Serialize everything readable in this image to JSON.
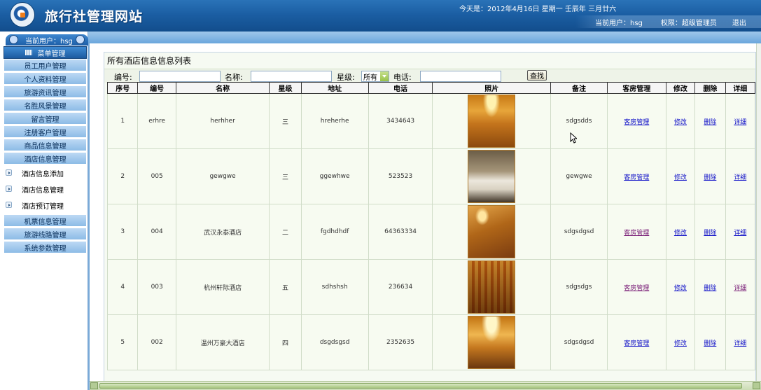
{
  "header": {
    "site_title": "旅行社管理网站",
    "date_text": "今天是：2012年4月16日 星期一 壬辰年 三月廿六",
    "current_user": "当前用户：hsg",
    "role": "权限：超级管理员",
    "logout": "退出"
  },
  "sidebar": {
    "user_label": "当前用户：hsg",
    "menu_head": "菜单管理",
    "items": [
      "员工用户管理",
      "个人资料管理",
      "旅游资讯管理",
      "名胜风景管理",
      "留言管理",
      "注册客户管理",
      "商品信息管理",
      "酒店信息管理"
    ],
    "sub_items": [
      "酒店信息添加",
      "酒店信息管理",
      "酒店预订管理"
    ],
    "items_after": [
      "机票信息管理",
      "旅游线路管理",
      "系统参数管理"
    ]
  },
  "panel": {
    "title": "所有酒店信息信息列表",
    "search": {
      "code_label": "编号:",
      "name_label": "名称:",
      "star_label": "星级:",
      "star_selected": "所有",
      "phone_label": "电话:",
      "button": "查找"
    }
  },
  "table": {
    "headers": [
      "序号",
      "编号",
      "名称",
      "星级",
      "地址",
      "电话",
      "照片",
      "备注",
      "客房管理",
      "修改",
      "删除",
      "详细"
    ],
    "rows": [
      {
        "no": "1",
        "code": "erhre",
        "name": "herhher",
        "star": "三",
        "addr": "hreherhe",
        "phone": "3434643",
        "photo": "ph-gold",
        "note": "sdgsdds",
        "room": "客房管理",
        "edit": "修改",
        "del": "删除",
        "detail": "详细"
      },
      {
        "no": "2",
        "code": "005",
        "name": "gewgwe",
        "star": "三",
        "addr": "ggewhwe",
        "phone": "523523",
        "photo": "ph-room",
        "note": "gewgwe",
        "room": "客房管理",
        "edit": "修改",
        "del": "删除",
        "detail": "详细"
      },
      {
        "no": "3",
        "code": "004",
        "name": "武汉永泰酒店",
        "star": "二",
        "addr": "fgdhdhdf",
        "phone": "64363334",
        "photo": "ph-warm",
        "note": "sdgsdgsd",
        "room": "客房管理",
        "edit": "修改",
        "del": "删除",
        "detail": "详细"
      },
      {
        "no": "4",
        "code": "003",
        "name": "杭州轩际酒店",
        "star": "五",
        "addr": "sdhshsh",
        "phone": "236634",
        "photo": "ph-hall",
        "note": "sdgsdgs",
        "room": "客房管理",
        "edit": "修改",
        "del": "删除",
        "detail": "详细"
      },
      {
        "no": "5",
        "code": "002",
        "name": "温州万豪大酒店",
        "star": "四",
        "addr": "dsgdsgsd",
        "phone": "2352635",
        "photo": "ph-chan",
        "note": "sdgsdgsd",
        "room": "客房管理",
        "edit": "修改",
        "del": "删除",
        "detail": "详细"
      }
    ]
  }
}
